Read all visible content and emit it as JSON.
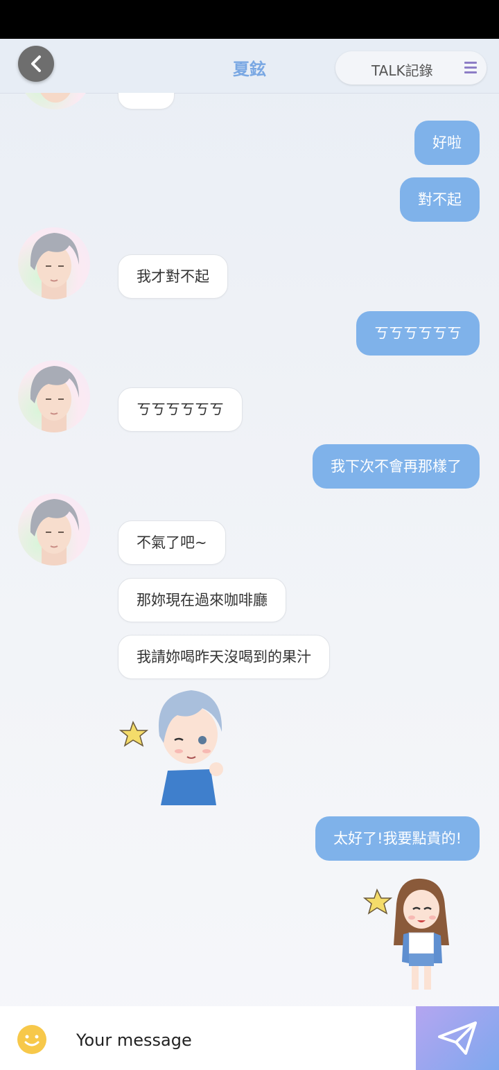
{
  "header": {
    "title": "夏鉉",
    "talk_log_label": "TALK記錄"
  },
  "messages": [
    {
      "from": "me",
      "text": "好啦"
    },
    {
      "from": "me",
      "text": "對不起"
    },
    {
      "from": "him",
      "text": "我才對不起"
    },
    {
      "from": "me",
      "text": "ㄎㄎㄎㄎㄎㄎ"
    },
    {
      "from": "him",
      "text": "ㄎㄎㄎㄎㄎㄎ"
    },
    {
      "from": "me",
      "text": "我下次不會再那樣了"
    },
    {
      "from": "him",
      "text": "不氣了吧~"
    },
    {
      "from": "him",
      "text": "那妳現在過來咖啡廳"
    },
    {
      "from": "him",
      "text": "我請妳喝昨天沒喝到的果汁"
    },
    {
      "from": "him",
      "type": "sticker",
      "name": "wink-heart-sticker"
    },
    {
      "from": "me",
      "text": "太好了!我要點貴的!"
    },
    {
      "from": "me",
      "type": "sticker",
      "name": "happy-girl-sticker"
    }
  ],
  "input": {
    "placeholder": "Your message"
  },
  "colors": {
    "accent": "#7fb2ea",
    "title": "#7aa8e3",
    "menu": "#8c7dc6"
  }
}
